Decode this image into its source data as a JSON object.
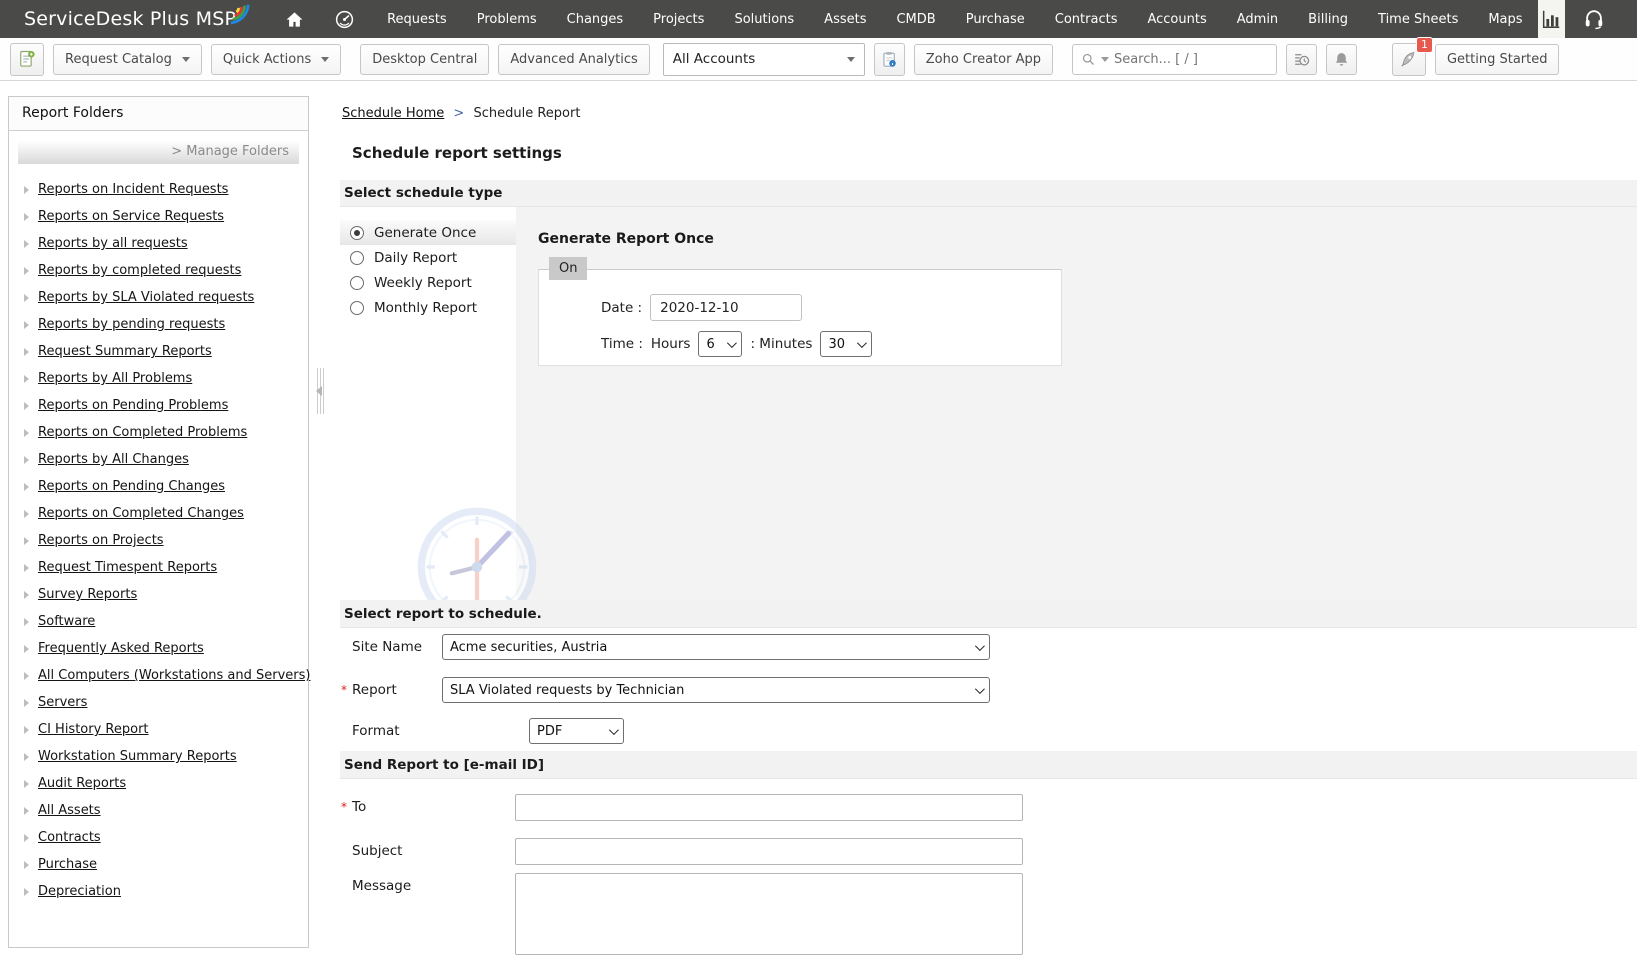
{
  "topnav": {
    "logo": "ServiceDesk Plus MSP",
    "items": [
      "Requests",
      "Problems",
      "Changes",
      "Projects",
      "Solutions",
      "Assets",
      "CMDB",
      "Purchase",
      "Contracts",
      "Accounts",
      "Admin",
      "Billing",
      "Time Sheets",
      "Maps"
    ],
    "icons": {
      "home": "home-icon",
      "dashboard": "gauge-icon",
      "reports": "bar-chart-icon",
      "support": "headset-icon"
    }
  },
  "toolbar": {
    "new_request_icon": "new-request-icon",
    "request_catalog": "Request Catalog",
    "quick_actions": "Quick Actions",
    "desktop_central": "Desktop Central",
    "advanced_analytics": "Advanced Analytics",
    "accounts_filter": "All Accounts",
    "account_info_icon": "account-info-icon",
    "zoho_creator": "Zoho Creator App",
    "search_placeholder": "Search... [ / ]",
    "recent_items_icon": "recent-items-icon",
    "notifications_icon": "bell-icon",
    "whats_new_icon": "rocket-icon",
    "whats_new_badge": "1",
    "getting_started": "Getting Started"
  },
  "sidebar": {
    "title": "Report Folders",
    "manage_folders": "> Manage Folders",
    "items": [
      "Reports on Incident Requests",
      "Reports on Service Requests",
      "Reports by all requests",
      "Reports by completed requests",
      "Reports by SLA Violated requests",
      "Reports by pending requests",
      "Request Summary Reports",
      "Reports by All Problems",
      "Reports on Pending Problems",
      "Reports on Completed Problems",
      "Reports by All Changes",
      "Reports on Pending Changes",
      "Reports on Completed Changes",
      "Reports on Projects",
      "Request Timespent Reports",
      "Survey Reports",
      "Software",
      "Frequently Asked Reports",
      "All Computers (Workstations and Servers)",
      "Servers",
      "CI History Report",
      "Workstation Summary Reports",
      "Audit Reports",
      "All Assets",
      "Contracts",
      "Purchase",
      "Depreciation"
    ]
  },
  "main": {
    "breadcrumb": {
      "home": "Schedule Home",
      "separator": ">",
      "current": "Schedule Report"
    },
    "page_title": "Schedule report settings",
    "schedule_type": {
      "header": "Select schedule type",
      "options": [
        "Generate Once",
        "Daily Report",
        "Weekly Report",
        "Monthly Report"
      ],
      "selected": "Generate Once"
    },
    "generate_once": {
      "title": "Generate Report Once",
      "tab": "On",
      "date_label": "Date :",
      "date_value": "2020-12-10",
      "time_label": "Time :",
      "hours_label": "Hours",
      "hours_value": "6",
      "minutes_label": ": Minutes",
      "minutes_value": "30"
    },
    "report_select": {
      "header": "Select report to schedule.",
      "required_marker": "*",
      "site_name_label": "Site Name",
      "site_name_value": "Acme securities, Austria",
      "report_label": "Report",
      "report_value": "SLA Violated requests by Technician",
      "format_label": "Format",
      "format_value": "PDF"
    },
    "send_report": {
      "header": "Send Report to [e-mail ID]",
      "required_marker": "*",
      "to_label": "To",
      "subject_label": "Subject",
      "message_label": "Message"
    }
  },
  "colors": {
    "nav_bg": "#4a4a48",
    "badge_red": "#e8594d",
    "section_gray": "#f2f2f2",
    "body_gray": "#f3f3f3"
  }
}
